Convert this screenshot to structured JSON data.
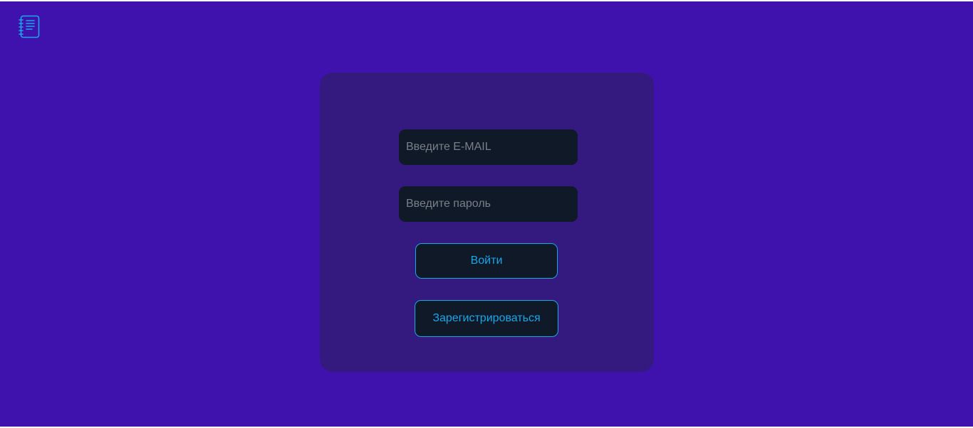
{
  "header": {
    "logo_icon": "notebook-icon",
    "accent_color": "#18a7e8"
  },
  "login_form": {
    "email_placeholder": "Введите E-MAIL",
    "email_value": "",
    "password_placeholder": "Введите пароль",
    "password_value": "",
    "login_label": "Войти",
    "register_label": "Зарегистрироваться"
  },
  "colors": {
    "background": "#4012ad",
    "card": "#341a7e",
    "field": "#0f1928",
    "accent": "#18a7e8"
  }
}
